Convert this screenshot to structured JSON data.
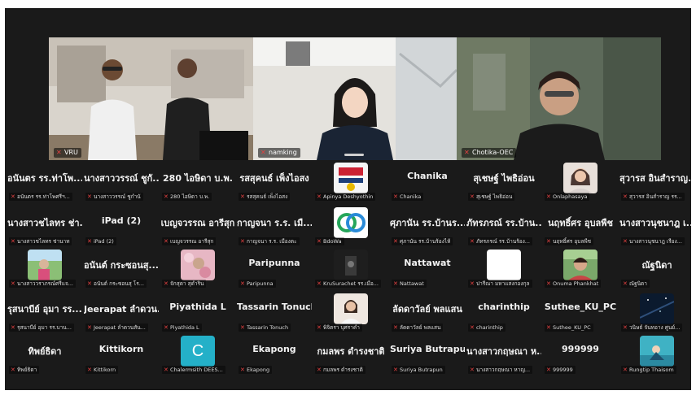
{
  "speakers": [
    {
      "name": "VRU",
      "muted": true
    },
    {
      "name": "namking",
      "muted": true
    },
    {
      "name": "Chotika-OEC",
      "muted": true,
      "active": true
    }
  ],
  "grid": [
    [
      {
        "big": "อนันตร รร.ท่าโพ...",
        "small": "อนันตร รร.ท่าโพศรีฯ..."
      },
      {
        "big": "นางสาววรรณ์ ชูกั...",
        "small": "นางสาววรรณ์ ชูกำนั"
      },
      {
        "big": "280 ไอษิดา บ.พ.",
        "small": "280 ไอษิดา บ.พ."
      },
      {
        "big": "รสสุคนธ์ เพ็งไอสง",
        "small": "รสสุคนธ์ เพ็งไอสง"
      },
      {
        "thumb": "logo-a",
        "small": "Apinya Deshyothin"
      },
      {
        "big": "Chanika",
        "small": "Chanika"
      },
      {
        "big": "สุเชษฐ์ ไพธิอ่อน",
        "small": "สุเชษฐ์ ไพธิอ่อน"
      },
      {
        "thumb": "face-a",
        "small": "Onlaphasaya"
      },
      {
        "big": "สุวารส อินสำราญ...",
        "small": "สุวารส อินสำราญ รร..."
      }
    ],
    [
      {
        "big": "นางสาวชไลทร ช่า...",
        "small": "นางสาวชไลทร ช่านาท"
      },
      {
        "big": "iPad (2)",
        "small": "iPad (2)"
      },
      {
        "big": "เบญจวรรณ อารีสุก",
        "small": "เบญจวรรณ อารีสุก"
      },
      {
        "big": "กาญจนา ร.ร. เมื...",
        "small": "กาญจนา ร.ร. เมืองตะ"
      },
      {
        "thumb": "logo-b",
        "small": "BdoWa"
      },
      {
        "big": "ศุภานัน รร.บ้านร...",
        "small": "ศุภานัน รร.บ้านร้องไห้"
      },
      {
        "big": "ภัทรภรณ์ รร.บ้าน...",
        "small": "ภัทรภรณ์ รร.บ้านร้อง..."
      },
      {
        "big": "นฤทธิ์ศร อุบลพืช",
        "small": "นฤทธิ์ศร อุบลพืช"
      },
      {
        "big": "นางสาวนุชนาฎ เ...",
        "small": "นางสาวนุชนาฎ เรือง..."
      }
    ],
    [
      {
        "thumb": "outdoor",
        "small": "นางสาววราภรณ์ศรีแจ..."
      },
      {
        "big": "อนันต์ กระซอนสุ...",
        "small": "อนันต์ กระซอนสุ โร..."
      },
      {
        "thumb": "flowers",
        "small": "จักสุดา สุดำริน"
      },
      {
        "big": "Paripunna",
        "small": "Paripunna"
      },
      {
        "thumb": "dark-room",
        "small": "KruSurachet รร.เมือ..."
      },
      {
        "big": "Nattawat",
        "small": "Nattawat"
      },
      {
        "thumb": "white",
        "small": "ปารีณา มหาแสงกองกุล"
      },
      {
        "thumb": "face-b",
        "small": "Onuma Phankhat"
      },
      {
        "big": "ณัฐนิดา",
        "small": "ณัฐนิดา"
      }
    ],
    [
      {
        "big": "รุสนาบีย์ อุมา รร....",
        "small": "รุสนาบีย์ อุมา รร.บาน..."
      },
      {
        "big": "Jeerapat ลำดวน...",
        "small": "Jeerapat ลำดวนสัน..."
      },
      {
        "big": "Piyathida L",
        "small": "Piyathida L"
      },
      {
        "big": "Tassarin Tonuch",
        "small": "Tassarin Tonuch"
      },
      {
        "thumb": "portrait",
        "small": "พิจิตรา บุศราคำ"
      },
      {
        "big": "ลัดดาวัลย์ พลแสน",
        "small": "ลัดดาวัลย์ พลแสน"
      },
      {
        "big": "charinthip",
        "small": "charinthip"
      },
      {
        "big": "Suthee_KU_PC",
        "small": "Suthee_KU_PC"
      },
      {
        "thumb": "night",
        "small": "วนิษธ์ จันทอาง ศูนย์..."
      }
    ],
    [
      {
        "big": "ทิพย์ธิดา",
        "small": "ทิพย์ธิดา"
      },
      {
        "big": "Kittikorn",
        "small": "Kittikorn"
      },
      {
        "thumb": "letter-c",
        "letter": "C",
        "small": "Chalermsith DEES..."
      },
      {
        "big": "Ekapong",
        "small": "Ekapong"
      },
      {
        "big": "กมลพร ดำรงชาติ",
        "small": "กมลพร ดำรงชาติ"
      },
      {
        "big": "Suriya Butrapun",
        "small": "Suriya Butrapun"
      },
      {
        "big": "นางสาวกฤษณา ห...",
        "small": "นางสาวกฤษณา หาญ..."
      },
      {
        "big": "999999",
        "small": "999999"
      },
      {
        "thumb": "underwater",
        "small": "Rungtip Thaisom"
      }
    ]
  ],
  "colors": {
    "active_border": "#37d07a",
    "mute_red": "#e34040",
    "tile_bg": "#1a1a1a"
  }
}
